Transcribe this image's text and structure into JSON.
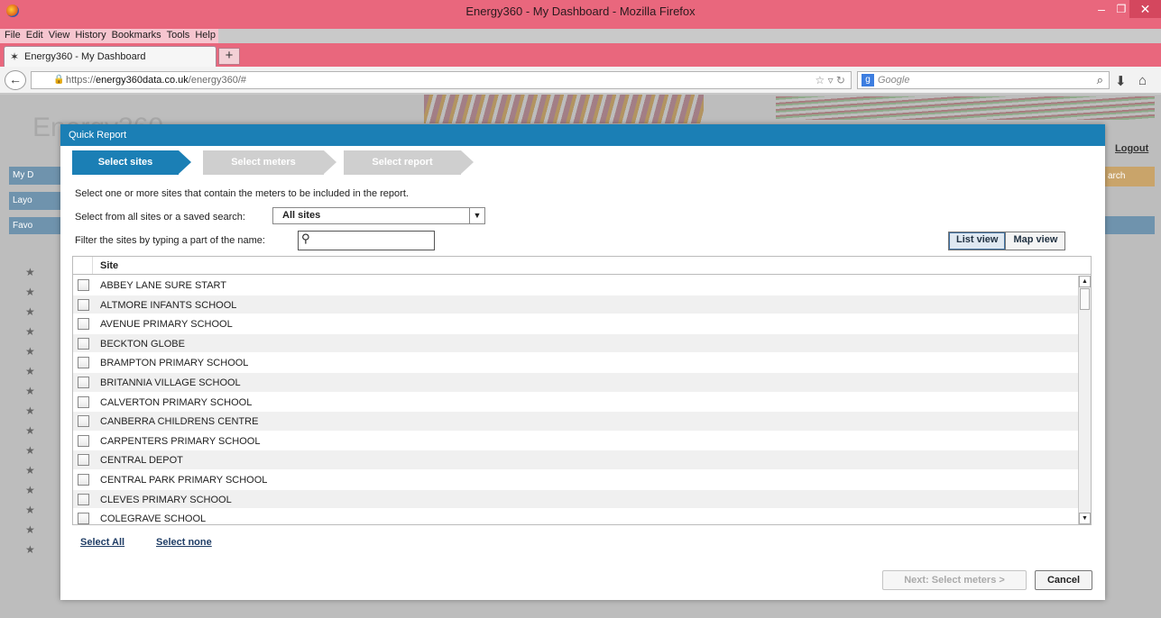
{
  "browser": {
    "window_title": "Energy360 - My Dashboard - Mozilla Firefox",
    "menu": [
      "File",
      "Edit",
      "View",
      "History",
      "Bookmarks",
      "Tools",
      "Help"
    ],
    "tab_title": "Energy360 - My Dashboard",
    "url_prefix": "https://",
    "url_domain": "energy360data.co.uk",
    "url_path": "/energy360/#",
    "search_engine": "Google"
  },
  "background": {
    "logo": "Energy360",
    "logout": "Logout",
    "search_btn": "arch",
    "side_items": [
      "My D",
      "Layo",
      "Favo"
    ]
  },
  "modal": {
    "title": "Quick Report",
    "steps": [
      {
        "label": "Select sites",
        "state": "active"
      },
      {
        "label": "Select meters",
        "state": "inactive"
      },
      {
        "label": "Select report",
        "state": "inactive"
      }
    ],
    "instructions": "Select one or more sites that contain the meters to be included in the report.",
    "saved_search_label": "Select from all sites or a saved search:",
    "saved_search_value": "All sites",
    "filter_label": "Filter the sites by typing a part of the name:",
    "filter_value": "",
    "view_list": "List view",
    "view_map": "Map view",
    "table_header": "Site",
    "sites": [
      "ABBEY LANE  SURE  START",
      "ALTMORE INFANTS SCHOOL",
      "AVENUE PRIMARY SCHOOL",
      "BECKTON GLOBE",
      "BRAMPTON PRIMARY SCHOOL",
      "BRITANNIA VILLAGE SCHOOL",
      "CALVERTON PRIMARY SCHOOL",
      "CANBERRA CHILDRENS CENTRE",
      "CARPENTERS PRIMARY SCHOOL",
      "CENTRAL DEPOT",
      "CENTRAL PARK PRIMARY SCHOOL",
      "CLEVES PRIMARY SCHOOL",
      "COLEGRAVE SCHOOL"
    ],
    "select_all": "Select All",
    "select_none": "Select none",
    "next_button": "Next: Select meters >",
    "cancel_button": "Cancel"
  },
  "colors": {
    "titlebar": "#e9677d",
    "accent": "#1b7fb5",
    "inactive_step": "#cfcfcf"
  }
}
